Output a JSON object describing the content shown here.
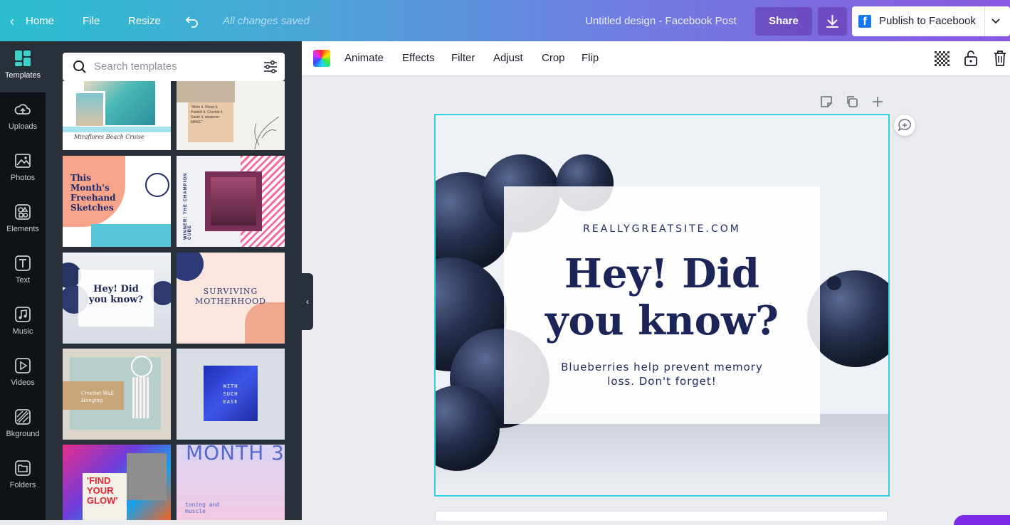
{
  "topbar": {
    "home": "Home",
    "file": "File",
    "resize": "Resize",
    "saved_status": "All changes saved",
    "design_title": "Untitled design - Facebook Post",
    "share": "Share",
    "publish": "Publish to Facebook"
  },
  "rail": {
    "items": [
      {
        "label": "Templates",
        "icon": "templates-icon"
      },
      {
        "label": "Uploads",
        "icon": "upload-cloud-icon"
      },
      {
        "label": "Photos",
        "icon": "photo-icon"
      },
      {
        "label": "Elements",
        "icon": "shapes-icon"
      },
      {
        "label": "Text",
        "icon": "text-icon"
      },
      {
        "label": "Music",
        "icon": "music-note-icon"
      },
      {
        "label": "Videos",
        "icon": "video-play-icon"
      },
      {
        "label": "Bkground",
        "icon": "background-pattern-icon"
      },
      {
        "label": "Folders",
        "icon": "folder-icon"
      }
    ]
  },
  "panel": {
    "search_placeholder": "Search templates",
    "templates": [
      {
        "caption": "Miraflores Beach Cruise"
      },
      {
        "caption": "\"Write it. Shoot it. Publish it. Crochet it. Sauté it, whatever. MAKE.\""
      },
      {
        "caption": "This Month's Freehand Sketches"
      },
      {
        "caption": "WINNER: THE CHAMPION CUBE"
      },
      {
        "caption": "Hey! Did you know?"
      },
      {
        "caption": "SURVIVING MOTHERHOOD"
      },
      {
        "caption": "Crochet Wall Hanging"
      },
      {
        "caption": "WITH SUCH EASE"
      },
      {
        "caption": "'FIND YOUR GLOW'"
      },
      {
        "caption": "MONTH 3",
        "sub": "toning and muscle"
      }
    ]
  },
  "toolbar": {
    "animate": "Animate",
    "effects": "Effects",
    "filter": "Filter",
    "adjust": "Adjust",
    "crop": "Crop",
    "flip": "Flip"
  },
  "canvas": {
    "site": "REALLYGREATSITE.COM",
    "headline_line1": "Hey! Did",
    "headline_line2": "you know?",
    "sub_line1": "Blueberries help prevent memory",
    "sub_line2": "loss. Don't forget!"
  },
  "colors": {
    "accent": "#33d1e0",
    "brand_purple": "#7d2ae8",
    "headline": "#1b2557"
  }
}
